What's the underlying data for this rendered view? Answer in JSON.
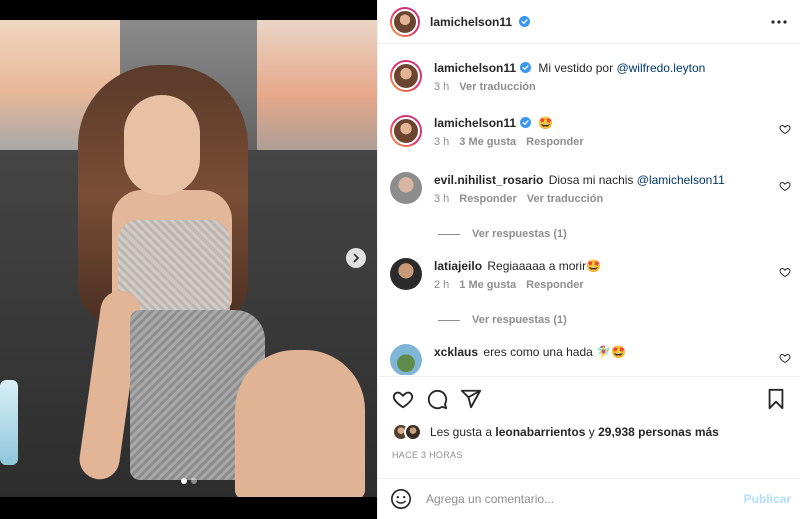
{
  "post": {
    "author": "lamichelson11",
    "carousel": {
      "current": 1,
      "total": 2
    }
  },
  "comments": [
    {
      "user": "lamichelson11",
      "verified": true,
      "text": "Mi vestido por",
      "mention": "@wilfredo.leyton",
      "time": "3 h",
      "translate": "Ver traducción",
      "is_caption": true
    },
    {
      "user": "lamichelson11",
      "verified": true,
      "text": "🤩",
      "time": "3 h",
      "likes": "3 Me gusta",
      "reply": "Responder"
    },
    {
      "user": "evil.nihilist_rosario",
      "verified": false,
      "text": "Diosa mi nachis",
      "mention": "@lamichelson11",
      "time": "3 h",
      "reply": "Responder",
      "translate": "Ver traducción",
      "view_replies": "Ver respuestas (1)"
    },
    {
      "user": "latiajeilo",
      "verified": false,
      "text": "Regiaaaaa a morir🤩",
      "time": "2 h",
      "likes": "1 Me gusta",
      "reply": "Responder",
      "view_replies": "Ver respuestas (1)"
    },
    {
      "user": "xcklaus",
      "verified": false,
      "text": "eres como una hada 🧚‍♀️🤩"
    }
  ],
  "likes": {
    "prefix": "Les gusta a",
    "user": "leonabarrientos",
    "conj": "y",
    "count_text": "29,938 personas más"
  },
  "timestamp": "HACE 3 HORAS",
  "composer": {
    "placeholder": "Agrega un comentario...",
    "post_label": "Publicar"
  },
  "colors": {
    "verified": "#3897f0",
    "link": "#00376b",
    "muted": "#8e8e8e",
    "post_disabled": "#b2dffc"
  },
  "icons": [
    "verified-badge-icon",
    "more-options-icon",
    "heart-icon",
    "comment-icon",
    "share-icon",
    "bookmark-icon",
    "emoji-icon",
    "chevron-right-icon"
  ]
}
